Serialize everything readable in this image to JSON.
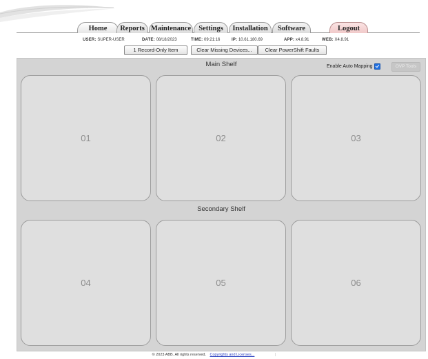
{
  "tabs": [
    {
      "label": "Home"
    },
    {
      "label": "Reports"
    },
    {
      "label": "Maintenance"
    },
    {
      "label": "Settings"
    },
    {
      "label": "Installation"
    },
    {
      "label": "Software"
    },
    {
      "label": "Logout"
    }
  ],
  "status": {
    "user_label": "USER:",
    "user_value": "SUPER-USER",
    "date_label": "DATE:",
    "date_value": "08/18/2023",
    "time_label": "TIME:",
    "time_value": "09:21:16",
    "ip_label": "IP:",
    "ip_value": "10.61.180.69",
    "app_label": "APP:",
    "app_value": "x4.8.91",
    "web_label": "WEB:",
    "web_value": "X4.8.91"
  },
  "actions": {
    "record_only": "1 Record-Only Item",
    "clear_missing": "Clear Missing Devices...",
    "clear_faults": "Clear PowerShift Faults"
  },
  "main_shelf": {
    "title": "Main Shelf",
    "slots": [
      "01",
      "02",
      "03"
    ]
  },
  "secondary_shelf": {
    "title": "Secondary Shelf",
    "slots": [
      "04",
      "05",
      "06"
    ]
  },
  "auto_mapping": {
    "label": "Enable Auto Mapping",
    "checked": true
  },
  "ovp_button": "OVP Tools",
  "footer": {
    "copyright": "© 2023 ABB. All rights reserved.",
    "link": "Copyrights and Licenses...",
    "separator": "|"
  },
  "colors": {
    "panel_bg": "#d4d4d4",
    "slot_bg": "#dfdfdf",
    "logout_tab": "#f1c9c9",
    "checkbox": "#1f6fe0",
    "link": "#2a3fc0"
  }
}
